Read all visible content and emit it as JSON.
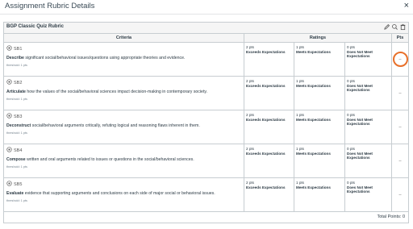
{
  "modal": {
    "title": "Assignment Rubric Details",
    "close_label": "×"
  },
  "rubric": {
    "title": "BGP Classic Quiz Rubric",
    "headers": {
      "criteria": "Criteria",
      "ratings": "Ratings",
      "pts": "Pts"
    },
    "criteria": [
      {
        "id": "SB1",
        "verb": "Describe",
        "text": " significant social/behavioral issues/questions using appropriate theories and evidence.",
        "threshold": "threshold: 1 pts",
        "ratings": [
          {
            "pts": "2 pts",
            "desc": "Exceeds Expectations"
          },
          {
            "pts": "1 pts",
            "desc": "Meets Expectations"
          },
          {
            "pts": "0 pts",
            "desc": "Does Not Meet Expectations"
          }
        ],
        "points": "--"
      },
      {
        "id": "SB2",
        "verb": "Articulate",
        "text": " how the values of the social/behavioral sciences impact decision-making in contemporary society.",
        "threshold": "threshold: 1 pts",
        "ratings": [
          {
            "pts": "2 pts",
            "desc": "Exceeds Expectations"
          },
          {
            "pts": "1 pts",
            "desc": "Meets Expectations"
          },
          {
            "pts": "0 pts",
            "desc": "Does Not Meet Expectations"
          }
        ],
        "points": "--"
      },
      {
        "id": "SB3",
        "verb": "Deconstruct",
        "text": " social/behavioral arguments critically, refuting logical and reasoning flaws inherent in them.",
        "threshold": "threshold: 1 pts",
        "ratings": [
          {
            "pts": "2 pts",
            "desc": "Exceeds Expectations"
          },
          {
            "pts": "1 pts",
            "desc": "Meets Expectations"
          },
          {
            "pts": "0 pts",
            "desc": "Does Not Meet Expectations"
          }
        ],
        "points": "--"
      },
      {
        "id": "SB4",
        "verb": "Compose",
        "text": " written and oral arguments related to issues or questions in the social/behavioral sciences.",
        "threshold": "threshold: 1 pts",
        "ratings": [
          {
            "pts": "2 pts",
            "desc": "Exceeds Expectations"
          },
          {
            "pts": "1 pts",
            "desc": "Meets Expectations"
          },
          {
            "pts": "0 pts",
            "desc": "Does Not Meet Expectations"
          }
        ],
        "points": "--"
      },
      {
        "id": "SB5",
        "verb": "Evaluate",
        "text": " evidence that supporting arguments and conclusions on each side of major social or behavioral issues.",
        "threshold": "threshold: 1 pts",
        "ratings": [
          {
            "pts": "2 pts",
            "desc": "Exceeds Expectations"
          },
          {
            "pts": "1 pts",
            "desc": "Meets Expectations"
          },
          {
            "pts": "0 pts",
            "desc": "Does Not Meet Expectations"
          }
        ],
        "points": "--"
      }
    ],
    "total_points": "Total Points: 0"
  },
  "colors": {
    "highlight": "#e8702a",
    "border": "#c7cdd1",
    "header_bg": "#f5f5f5"
  },
  "icons": {
    "edit": "pencil-icon",
    "search": "search-icon",
    "delete": "trash-icon",
    "outcome": "outcome-icon"
  }
}
